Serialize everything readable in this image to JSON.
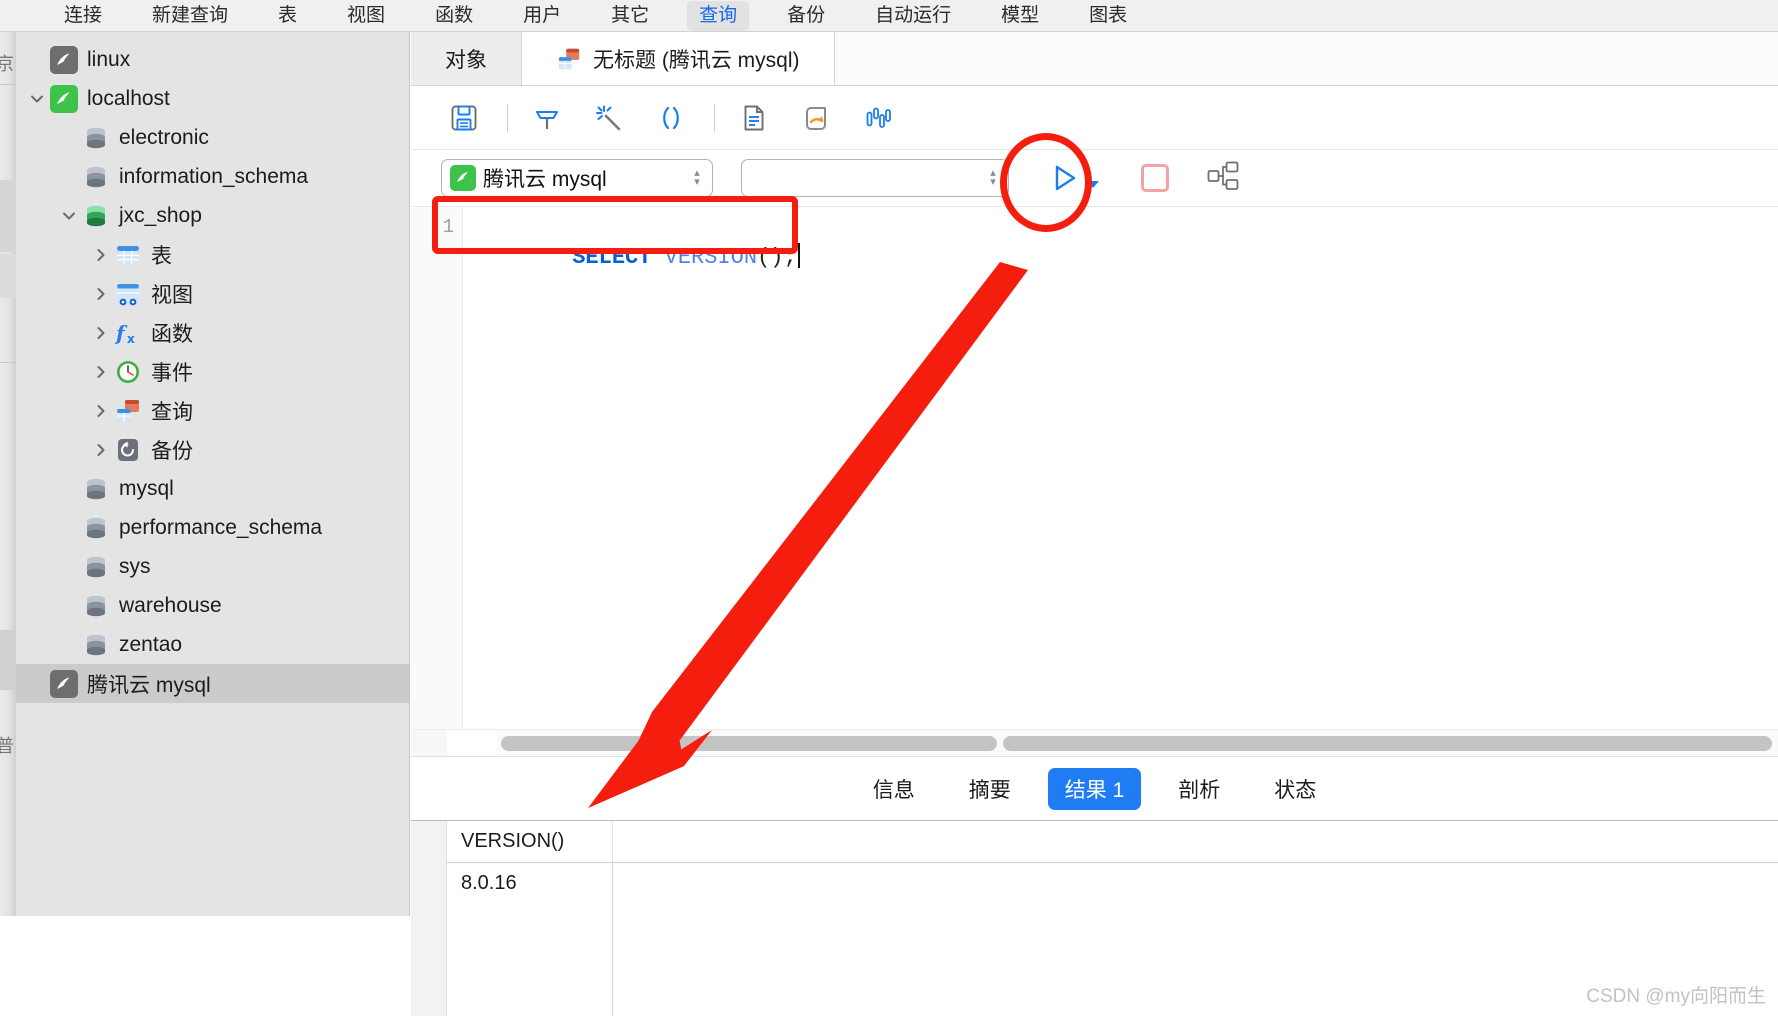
{
  "menubar": {
    "items": [
      {
        "label": "连接",
        "active": false
      },
      {
        "label": "新建查询",
        "active": false
      },
      {
        "label": "表",
        "active": false
      },
      {
        "label": "视图",
        "active": false
      },
      {
        "label": "函数",
        "active": false
      },
      {
        "label": "用户",
        "active": false
      },
      {
        "label": "其它",
        "active": false
      },
      {
        "label": "查询",
        "active": true
      },
      {
        "label": "备份",
        "active": false
      },
      {
        "label": "自动运行",
        "active": false
      },
      {
        "label": "模型",
        "active": false
      },
      {
        "label": "图表",
        "active": false
      }
    ]
  },
  "left_strip": {
    "top_text": "京",
    "bottom_text": "普"
  },
  "sidebar": {
    "items": [
      {
        "label": "linux",
        "indent": 0,
        "twisty": "none",
        "icon": "mysql-gray-icon"
      },
      {
        "label": "localhost",
        "indent": 0,
        "twisty": "expanded",
        "icon": "mysql-green-icon"
      },
      {
        "label": "electronic",
        "indent": 1,
        "twisty": "none",
        "icon": "database-gray-icon"
      },
      {
        "label": "information_schema",
        "indent": 1,
        "twisty": "none",
        "icon": "database-gray-icon"
      },
      {
        "label": "jxc_shop",
        "indent": 1,
        "twisty": "expanded",
        "icon": "database-green-icon"
      },
      {
        "label": "表",
        "indent": 2,
        "twisty": "collapsed",
        "icon": "table-icon"
      },
      {
        "label": "视图",
        "indent": 2,
        "twisty": "collapsed",
        "icon": "view-icon"
      },
      {
        "label": "函数",
        "indent": 2,
        "twisty": "collapsed",
        "icon": "function-icon"
      },
      {
        "label": "事件",
        "indent": 2,
        "twisty": "collapsed",
        "icon": "event-clock-icon"
      },
      {
        "label": "查询",
        "indent": 2,
        "twisty": "collapsed",
        "icon": "query-icon"
      },
      {
        "label": "备份",
        "indent": 2,
        "twisty": "collapsed",
        "icon": "backup-icon"
      },
      {
        "label": "mysql",
        "indent": 1,
        "twisty": "none",
        "icon": "database-gray-icon"
      },
      {
        "label": "performance_schema",
        "indent": 1,
        "twisty": "none",
        "icon": "database-gray-icon"
      },
      {
        "label": "sys",
        "indent": 1,
        "twisty": "none",
        "icon": "database-gray-icon"
      },
      {
        "label": "warehouse",
        "indent": 1,
        "twisty": "none",
        "icon": "database-gray-icon"
      },
      {
        "label": "zentao",
        "indent": 1,
        "twisty": "none",
        "icon": "database-gray-icon"
      },
      {
        "label": "腾讯云 mysql",
        "indent": 0,
        "twisty": "none",
        "icon": "mysql-gray-icon",
        "selected": true
      }
    ]
  },
  "pane_tabs": [
    {
      "label": "对象",
      "active": false,
      "icon": null
    },
    {
      "label": "无标题 (腾讯云 mysql)",
      "active": true,
      "icon": "query-icon"
    }
  ],
  "editor_toolbar": {
    "buttons": [
      {
        "name": "save-icon",
        "title": "保存"
      },
      {
        "name": "query-builder-icon",
        "title": "查询创建工具"
      },
      {
        "name": "beautify-wand-icon",
        "title": "美化 SQL"
      },
      {
        "name": "parentheses-icon",
        "title": "代码片段"
      },
      {
        "name": "text-document-icon",
        "title": "文本"
      },
      {
        "name": "export-arrow-icon",
        "title": "导出结果"
      },
      {
        "name": "chart-bars-icon",
        "title": "图表"
      }
    ]
  },
  "connection_bar": {
    "database": "腾讯云 mysql",
    "schema": "",
    "run_label": "运行",
    "stop_label": "停止",
    "explain_label": "解释"
  },
  "editor": {
    "line_number": "1",
    "code": "SELECT VERSION();",
    "tokens": [
      {
        "text": "SELECT",
        "type": "keyword"
      },
      {
        "text": " ",
        "type": "plain"
      },
      {
        "text": "VERSION",
        "type": "function"
      },
      {
        "text": "();",
        "type": "plain"
      }
    ]
  },
  "result_tabs": [
    {
      "label": "信息",
      "active": false
    },
    {
      "label": "摘要",
      "active": false
    },
    {
      "label": "结果 1",
      "active": true
    },
    {
      "label": "剖析",
      "active": false
    },
    {
      "label": "状态",
      "active": false
    }
  ],
  "result_grid": {
    "columns": [
      "VERSION()"
    ],
    "rows": [
      [
        "8.0.16"
      ]
    ]
  },
  "annotations": {
    "highlight_box": "sql-editor-line-highlight",
    "highlight_circle": "run-button-highlight",
    "arrow": "points-to-result-value"
  },
  "watermark": "CSDN @my向阳而生",
  "colors": {
    "accent": "#1f7cf2",
    "annotation_red": "#f41d0e",
    "menu_active_text": "#1669e8",
    "keyword": "#0b5fd4",
    "function": "#4f83e8"
  }
}
